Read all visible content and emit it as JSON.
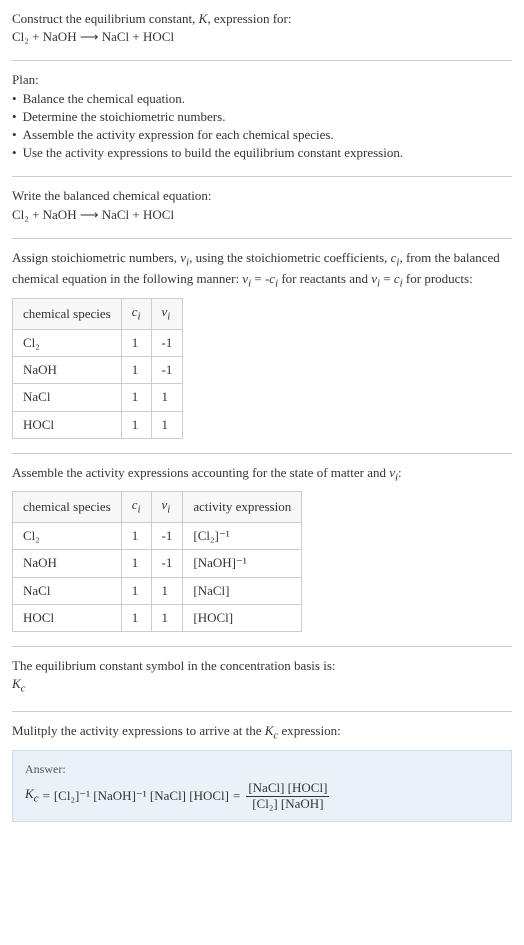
{
  "intro": {
    "line1": "Construct the equilibrium constant, K, expression for:",
    "equation": "Cl₂ + NaOH ⟶ NaCl + HOCl"
  },
  "plan": {
    "heading": "Plan:",
    "items": [
      "Balance the chemical equation.",
      "Determine the stoichiometric numbers.",
      "Assemble the activity expression for each chemical species.",
      "Use the activity expressions to build the equilibrium constant expression."
    ]
  },
  "balanced": {
    "heading": "Write the balanced chemical equation:",
    "equation": "Cl₂ + NaOH ⟶ NaCl + HOCl"
  },
  "assign": {
    "text": "Assign stoichiometric numbers, νᵢ, using the stoichiometric coefficients, cᵢ, from the balanced chemical equation in the following manner: νᵢ = -cᵢ for reactants and νᵢ = cᵢ for products:",
    "headers": [
      "chemical species",
      "cᵢ",
      "νᵢ"
    ],
    "rows": [
      [
        "Cl₂",
        "1",
        "-1"
      ],
      [
        "NaOH",
        "1",
        "-1"
      ],
      [
        "NaCl",
        "1",
        "1"
      ],
      [
        "HOCl",
        "1",
        "1"
      ]
    ]
  },
  "activity": {
    "text": "Assemble the activity expressions accounting for the state of matter and νᵢ:",
    "headers": [
      "chemical species",
      "cᵢ",
      "νᵢ",
      "activity expression"
    ],
    "rows": [
      [
        "Cl₂",
        "1",
        "-1",
        "[Cl₂]⁻¹"
      ],
      [
        "NaOH",
        "1",
        "-1",
        "[NaOH]⁻¹"
      ],
      [
        "NaCl",
        "1",
        "1",
        "[NaCl]"
      ],
      [
        "HOCl",
        "1",
        "1",
        "[HOCl]"
      ]
    ]
  },
  "symbol": {
    "text": "The equilibrium constant symbol in the concentration basis is:",
    "kc": "K_c"
  },
  "multiply": {
    "text": "Mulitply the activity expressions to arrive at the K_c expression:"
  },
  "answer": {
    "label": "Answer:",
    "lhs_k": "K_c",
    "eq": " = ",
    "prod": "[Cl₂]⁻¹ [NaOH]⁻¹ [NaCl] [HOCl]",
    "eq2": " = ",
    "frac_num": "[NaCl] [HOCl]",
    "frac_den": "[Cl₂] [NaOH]"
  }
}
